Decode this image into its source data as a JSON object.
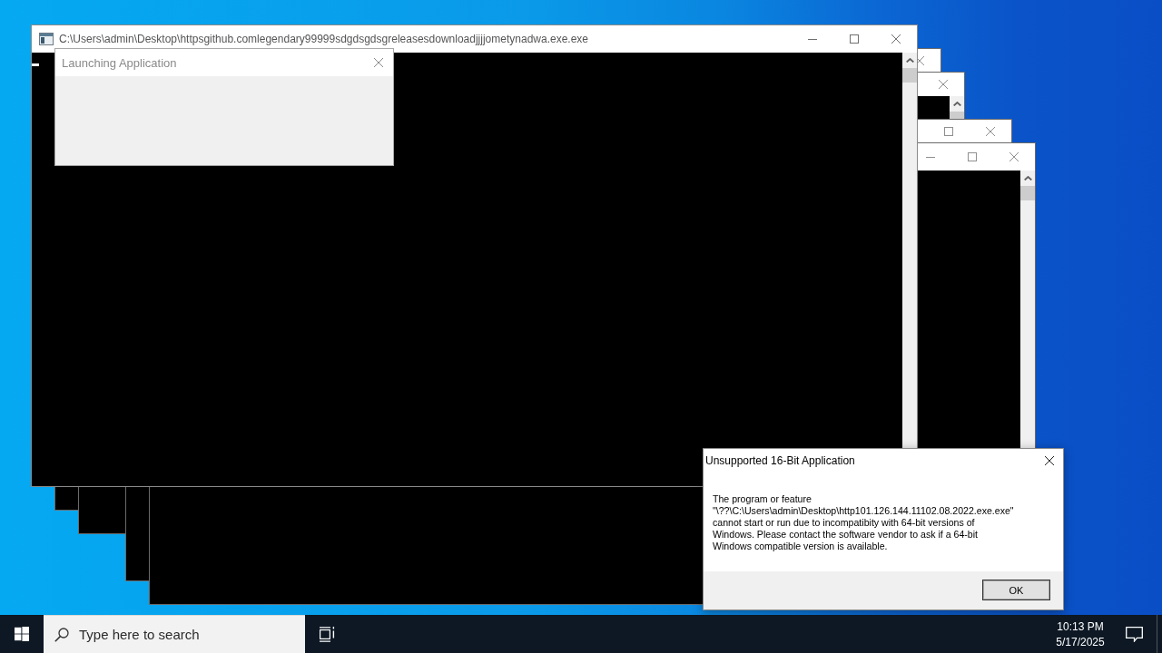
{
  "console_windows": [
    {
      "title_buttons": [
        {
          "kind": "close"
        }
      ]
    },
    {
      "title_buttons": [
        {
          "kind": "close"
        }
      ]
    },
    {
      "title_buttons": [
        {
          "kind": "maximize"
        },
        {
          "kind": "close"
        }
      ]
    },
    {
      "title_buttons": [
        {
          "kind": "minimize"
        },
        {
          "kind": "maximize"
        },
        {
          "kind": "close"
        }
      ]
    }
  ],
  "main_window": {
    "title": "C:\\Users\\admin\\Desktop\\httpsgithub.comlegendary99999sdgdsgdsgreleasesdownloadjjjjometynadwa.exe.exe",
    "title_buttons": [
      {
        "kind": "minimize"
      },
      {
        "kind": "maximize"
      },
      {
        "kind": "close"
      }
    ],
    "cursor": true
  },
  "launch_dialog": {
    "title": "Launching Application",
    "title_buttons": [
      {
        "kind": "close"
      }
    ]
  },
  "error_dialog": {
    "title": "Unsupported 16-Bit Application",
    "title_buttons": [
      {
        "kind": "close"
      }
    ],
    "message": "The program or feature\n\"\\??\\C:\\Users\\admin\\Desktop\\http101.126.144.11102.08.2022.exe.exe\"\ncannot start or run due to incompatibity with 64-bit versions of\nWindows. Please contact the software vendor to ask if a 64-bit\nWindows compatible version is available.",
    "buttons": [
      "OK"
    ]
  },
  "taskbar": {
    "search": {
      "placeholder": "Type here to search"
    },
    "clock": {
      "time": "10:13 PM",
      "date": "5/17/2025"
    }
  }
}
